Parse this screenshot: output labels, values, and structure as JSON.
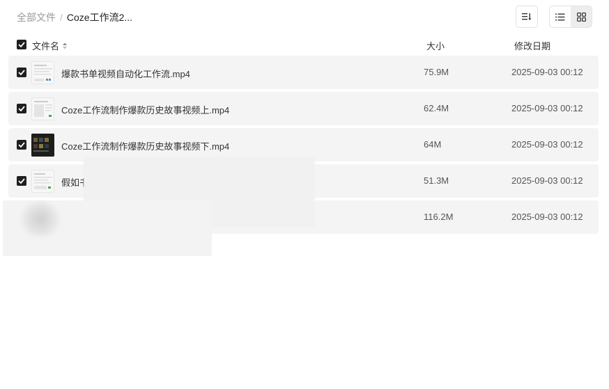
{
  "breadcrumb": {
    "root": "全部文件",
    "separator": "/",
    "current": "Coze工作流2..."
  },
  "toolbar": {
    "sort_icon": "sort-icon",
    "list_view_icon": "list-view-icon",
    "grid_view_icon": "grid-view-icon",
    "active_view": "list"
  },
  "table": {
    "headers": {
      "name": "文件名",
      "size": "大小",
      "date": "修改日期"
    },
    "select_all_checked": true,
    "rows": [
      {
        "name": "爆款书单视频自动化工作流.mp4",
        "size": "75.9M",
        "date": "2025-09-03 00:12",
        "checked": true,
        "thumb": "light"
      },
      {
        "name": "Coze工作流制作爆款历史故事视频上.mp4",
        "size": "62.4M",
        "date": "2025-09-03 00:12",
        "checked": true,
        "thumb": "light"
      },
      {
        "name": "Coze工作流制作爆款历史故事视频下.mp4",
        "size": "64M",
        "date": "2025-09-03 00:12",
        "checked": true,
        "thumb": "dark"
      },
      {
        "name": "假如书",
        "size": "51.3M",
        "date": "2025-09-03 00:12",
        "checked": true,
        "thumb": "light"
      },
      {
        "name": "",
        "size": "116.2M",
        "date": "2025-09-03 00:12",
        "checked": false,
        "thumb": "none"
      }
    ]
  },
  "colors": {
    "row_bg": "#f4f4f4",
    "checkbox": "#1f1f1f",
    "text": "#333333",
    "muted": "#999999"
  }
}
